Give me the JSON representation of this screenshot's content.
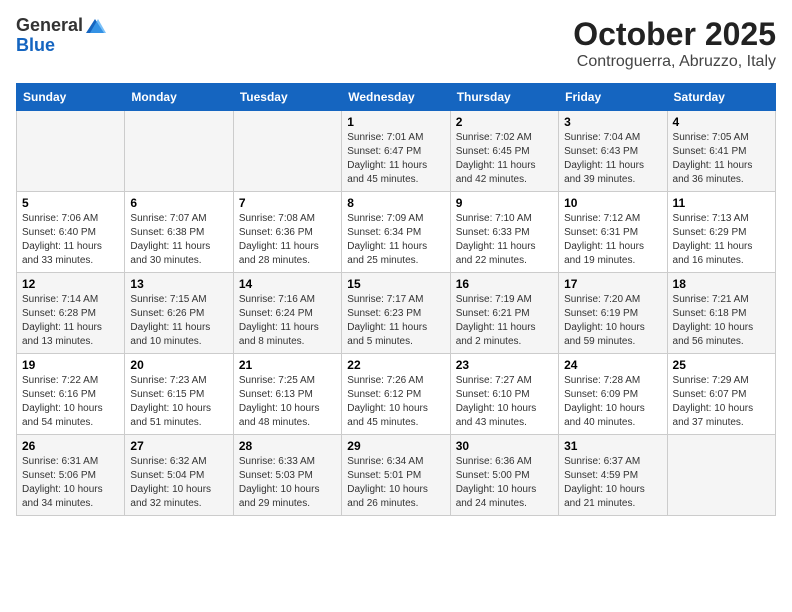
{
  "logo": {
    "general": "General",
    "blue": "Blue"
  },
  "title": "October 2025",
  "location": "Controguerra, Abruzzo, Italy",
  "days_of_week": [
    "Sunday",
    "Monday",
    "Tuesday",
    "Wednesday",
    "Thursday",
    "Friday",
    "Saturday"
  ],
  "weeks": [
    [
      {
        "day": "",
        "info": ""
      },
      {
        "day": "",
        "info": ""
      },
      {
        "day": "",
        "info": ""
      },
      {
        "day": "1",
        "info": "Sunrise: 7:01 AM\nSunset: 6:47 PM\nDaylight: 11 hours\nand 45 minutes."
      },
      {
        "day": "2",
        "info": "Sunrise: 7:02 AM\nSunset: 6:45 PM\nDaylight: 11 hours\nand 42 minutes."
      },
      {
        "day": "3",
        "info": "Sunrise: 7:04 AM\nSunset: 6:43 PM\nDaylight: 11 hours\nand 39 minutes."
      },
      {
        "day": "4",
        "info": "Sunrise: 7:05 AM\nSunset: 6:41 PM\nDaylight: 11 hours\nand 36 minutes."
      }
    ],
    [
      {
        "day": "5",
        "info": "Sunrise: 7:06 AM\nSunset: 6:40 PM\nDaylight: 11 hours\nand 33 minutes."
      },
      {
        "day": "6",
        "info": "Sunrise: 7:07 AM\nSunset: 6:38 PM\nDaylight: 11 hours\nand 30 minutes."
      },
      {
        "day": "7",
        "info": "Sunrise: 7:08 AM\nSunset: 6:36 PM\nDaylight: 11 hours\nand 28 minutes."
      },
      {
        "day": "8",
        "info": "Sunrise: 7:09 AM\nSunset: 6:34 PM\nDaylight: 11 hours\nand 25 minutes."
      },
      {
        "day": "9",
        "info": "Sunrise: 7:10 AM\nSunset: 6:33 PM\nDaylight: 11 hours\nand 22 minutes."
      },
      {
        "day": "10",
        "info": "Sunrise: 7:12 AM\nSunset: 6:31 PM\nDaylight: 11 hours\nand 19 minutes."
      },
      {
        "day": "11",
        "info": "Sunrise: 7:13 AM\nSunset: 6:29 PM\nDaylight: 11 hours\nand 16 minutes."
      }
    ],
    [
      {
        "day": "12",
        "info": "Sunrise: 7:14 AM\nSunset: 6:28 PM\nDaylight: 11 hours\nand 13 minutes."
      },
      {
        "day": "13",
        "info": "Sunrise: 7:15 AM\nSunset: 6:26 PM\nDaylight: 11 hours\nand 10 minutes."
      },
      {
        "day": "14",
        "info": "Sunrise: 7:16 AM\nSunset: 6:24 PM\nDaylight: 11 hours\nand 8 minutes."
      },
      {
        "day": "15",
        "info": "Sunrise: 7:17 AM\nSunset: 6:23 PM\nDaylight: 11 hours\nand 5 minutes."
      },
      {
        "day": "16",
        "info": "Sunrise: 7:19 AM\nSunset: 6:21 PM\nDaylight: 11 hours\nand 2 minutes."
      },
      {
        "day": "17",
        "info": "Sunrise: 7:20 AM\nSunset: 6:19 PM\nDaylight: 10 hours\nand 59 minutes."
      },
      {
        "day": "18",
        "info": "Sunrise: 7:21 AM\nSunset: 6:18 PM\nDaylight: 10 hours\nand 56 minutes."
      }
    ],
    [
      {
        "day": "19",
        "info": "Sunrise: 7:22 AM\nSunset: 6:16 PM\nDaylight: 10 hours\nand 54 minutes."
      },
      {
        "day": "20",
        "info": "Sunrise: 7:23 AM\nSunset: 6:15 PM\nDaylight: 10 hours\nand 51 minutes."
      },
      {
        "day": "21",
        "info": "Sunrise: 7:25 AM\nSunset: 6:13 PM\nDaylight: 10 hours\nand 48 minutes."
      },
      {
        "day": "22",
        "info": "Sunrise: 7:26 AM\nSunset: 6:12 PM\nDaylight: 10 hours\nand 45 minutes."
      },
      {
        "day": "23",
        "info": "Sunrise: 7:27 AM\nSunset: 6:10 PM\nDaylight: 10 hours\nand 43 minutes."
      },
      {
        "day": "24",
        "info": "Sunrise: 7:28 AM\nSunset: 6:09 PM\nDaylight: 10 hours\nand 40 minutes."
      },
      {
        "day": "25",
        "info": "Sunrise: 7:29 AM\nSunset: 6:07 PM\nDaylight: 10 hours\nand 37 minutes."
      }
    ],
    [
      {
        "day": "26",
        "info": "Sunrise: 6:31 AM\nSunset: 5:06 PM\nDaylight: 10 hours\nand 34 minutes."
      },
      {
        "day": "27",
        "info": "Sunrise: 6:32 AM\nSunset: 5:04 PM\nDaylight: 10 hours\nand 32 minutes."
      },
      {
        "day": "28",
        "info": "Sunrise: 6:33 AM\nSunset: 5:03 PM\nDaylight: 10 hours\nand 29 minutes."
      },
      {
        "day": "29",
        "info": "Sunrise: 6:34 AM\nSunset: 5:01 PM\nDaylight: 10 hours\nand 26 minutes."
      },
      {
        "day": "30",
        "info": "Sunrise: 6:36 AM\nSunset: 5:00 PM\nDaylight: 10 hours\nand 24 minutes."
      },
      {
        "day": "31",
        "info": "Sunrise: 6:37 AM\nSunset: 4:59 PM\nDaylight: 10 hours\nand 21 minutes."
      },
      {
        "day": "",
        "info": ""
      }
    ]
  ]
}
